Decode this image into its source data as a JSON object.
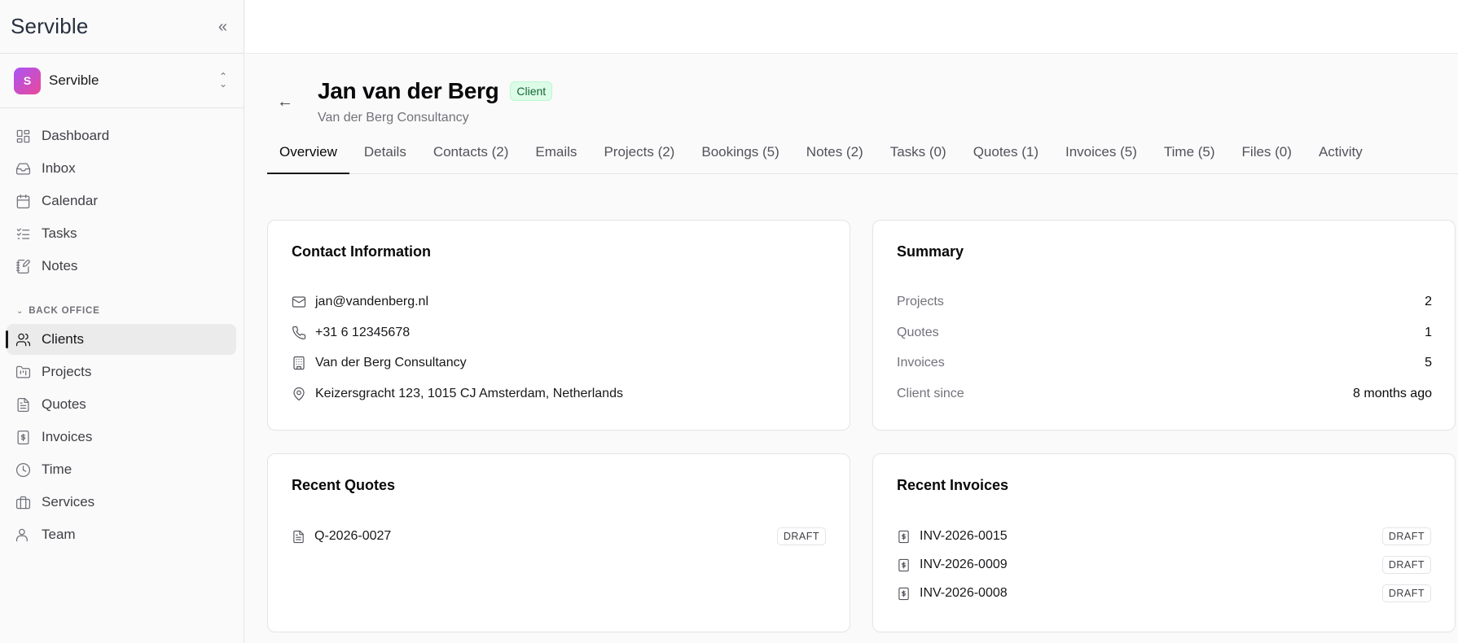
{
  "brand": {
    "logo": "Servible",
    "collapse_icon": "double-chevron-left-icon"
  },
  "workspace": {
    "initial": "S",
    "name": "Servible"
  },
  "nav": [
    {
      "label": "Dashboard",
      "icon": "dashboard-icon"
    },
    {
      "label": "Inbox",
      "icon": "inbox-icon"
    },
    {
      "label": "Calendar",
      "icon": "calendar-icon"
    },
    {
      "label": "Tasks",
      "icon": "tasks-icon"
    },
    {
      "label": "Notes",
      "icon": "notes-icon"
    }
  ],
  "back_office": {
    "label": "BACK OFFICE",
    "items": [
      {
        "label": "Clients",
        "icon": "users-icon",
        "active": true
      },
      {
        "label": "Projects",
        "icon": "folder-icon"
      },
      {
        "label": "Quotes",
        "icon": "file-icon"
      },
      {
        "label": "Invoices",
        "icon": "invoice-icon"
      },
      {
        "label": "Time",
        "icon": "clock-icon"
      },
      {
        "label": "Services",
        "icon": "briefcase-icon"
      },
      {
        "label": "Team",
        "icon": "user-icon"
      }
    ]
  },
  "client": {
    "name": "Jan van der Berg",
    "badge": "Client",
    "company": "Van der Berg Consultancy"
  },
  "tabs": [
    "Overview",
    "Details",
    "Contacts (2)",
    "Emails",
    "Projects (2)",
    "Bookings (5)",
    "Notes (2)",
    "Tasks (0)",
    "Quotes (1)",
    "Invoices (5)",
    "Time (5)",
    "Files (0)",
    "Activity"
  ],
  "active_tab": "Overview",
  "contact_info": {
    "title": "Contact Information",
    "email": "jan@vandenberg.nl",
    "phone": "+31 6 12345678",
    "company": "Van der Berg Consultancy",
    "address": "Keizersgracht 123, 1015 CJ Amsterdam, Netherlands"
  },
  "summary": {
    "title": "Summary",
    "rows": [
      {
        "label": "Projects",
        "value": "2"
      },
      {
        "label": "Quotes",
        "value": "1"
      },
      {
        "label": "Invoices",
        "value": "5"
      },
      {
        "label": "Client since",
        "value": "8 months ago"
      }
    ]
  },
  "recent_quotes": {
    "title": "Recent Quotes",
    "items": [
      {
        "id": "Q-2026-0027",
        "status": "DRAFT"
      }
    ]
  },
  "recent_invoices": {
    "title": "Recent Invoices",
    "items": [
      {
        "id": "INV-2026-0015",
        "status": "DRAFT"
      },
      {
        "id": "INV-2026-0009",
        "status": "DRAFT"
      },
      {
        "id": "INV-2026-0008",
        "status": "DRAFT"
      }
    ]
  },
  "colors": {
    "accent": "#18181b",
    "client_badge_bg": "#dcfce7",
    "client_badge_text": "#166534",
    "avatar_gradient": [
      "#a855f7",
      "#ec4899"
    ]
  }
}
